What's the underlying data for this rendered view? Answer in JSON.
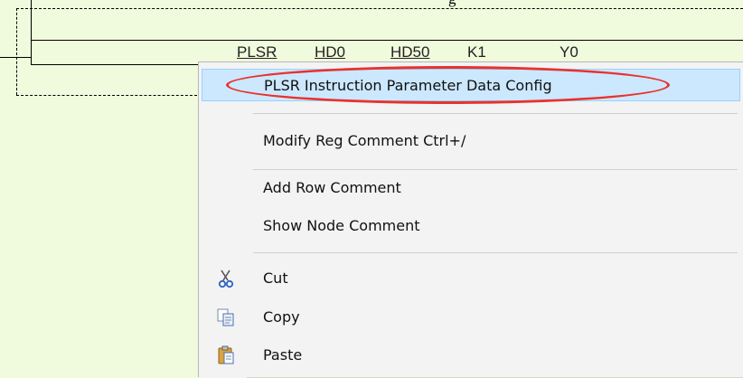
{
  "window": {
    "caption_fragment": "g"
  },
  "ladder": {
    "instruction": {
      "mnemonic": "PLSR",
      "operand1": "HD0",
      "operand2": "HD50",
      "operand3": "K1",
      "operand4": "Y0"
    }
  },
  "context_menu": {
    "items": [
      {
        "label": "PLSR Instruction Parameter Data Config",
        "icon": "",
        "highlighted": true
      },
      {
        "label": "Modify Reg Comment  Ctrl+/",
        "icon": ""
      },
      {
        "label": "Add Row Comment",
        "icon": ""
      },
      {
        "label": "Show Node Comment",
        "icon": ""
      },
      {
        "label": "Cut",
        "icon": "scissors-icon"
      },
      {
        "label": "Copy",
        "icon": "copy-icon"
      },
      {
        "label": "Paste",
        "icon": "paste-icon"
      }
    ]
  },
  "annotation": {
    "color": "#e8322c"
  },
  "colors": {
    "ladder_background": "#f0fadc",
    "menu_highlight": "#cce8ff"
  }
}
